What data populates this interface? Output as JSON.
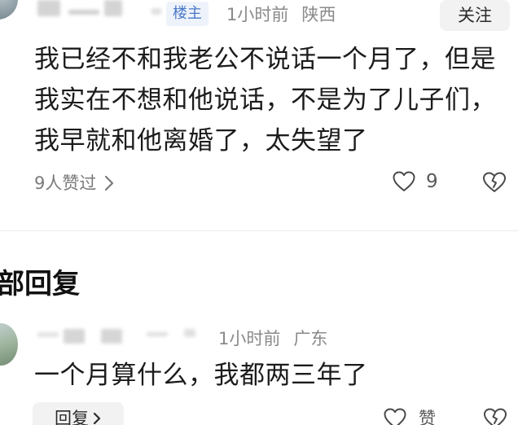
{
  "main_comment": {
    "badge": "楼主",
    "time": "1小时前",
    "location": "陕西",
    "follow_label": "关注",
    "text": "我已经不和我老公不说话一个月了，但是我实在不想和他说话，不是为了儿子们，我早就和他离婚了，太失望了",
    "likers_text": "9人赞过",
    "like_count": "9",
    "icons": {
      "like": "heart-outline-icon",
      "dislike": "broken-heart-icon",
      "likers_arrow": "chevron-right-icon"
    }
  },
  "replies_section": {
    "title": "部回复"
  },
  "reply": {
    "time": "1小时前",
    "location": "广东",
    "text": "一个月算什么，我都两三年了",
    "reply_label": "回复",
    "like_label": "赞",
    "icons": {
      "reply_arrow": "chevron-right-icon",
      "like": "heart-outline-icon",
      "dislike": "broken-heart-icon"
    }
  },
  "colors": {
    "badge_text": "#4a78c8",
    "badge_bg": "#eef3fb",
    "meta_text": "#8a8a8a",
    "body_text": "#1c1c1c",
    "button_bg": "#f2f2f2"
  }
}
